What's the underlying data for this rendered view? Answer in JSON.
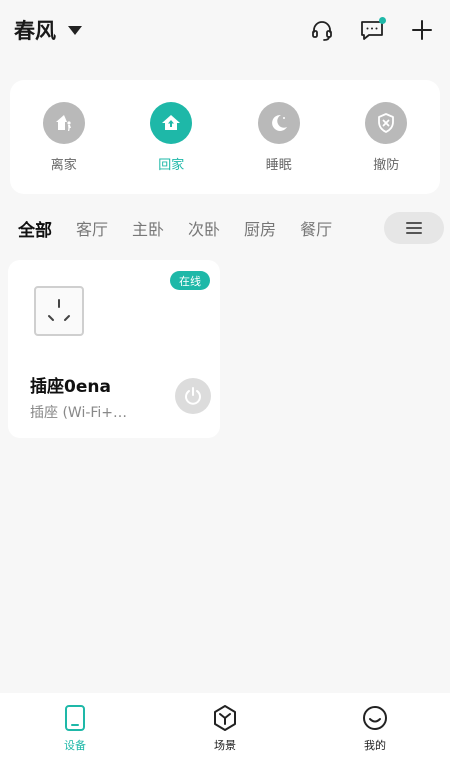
{
  "header": {
    "home_name": "春风",
    "icons": [
      "headset-icon",
      "message-icon",
      "plus-icon"
    ],
    "has_unread_message": true
  },
  "modes": [
    {
      "label": "离家",
      "icon": "leave-home-icon",
      "active": false
    },
    {
      "label": "回家",
      "icon": "go-home-icon",
      "active": true
    },
    {
      "label": "睡眠",
      "icon": "moon-icon",
      "active": false
    },
    {
      "label": "撤防",
      "icon": "shield-x-icon",
      "active": false
    }
  ],
  "rooms": [
    {
      "label": "全部",
      "active": true
    },
    {
      "label": "客厅",
      "active": false
    },
    {
      "label": "主卧",
      "active": false
    },
    {
      "label": "次卧",
      "active": false
    },
    {
      "label": "厨房",
      "active": false
    },
    {
      "label": "餐厅",
      "active": false
    }
  ],
  "devices": [
    {
      "status": "在线",
      "name": "插座0ena",
      "type": "插座 (Wi-Fi+…",
      "icon": "socket-icon",
      "power": "off"
    }
  ],
  "bottom_nav": [
    {
      "label": "设备",
      "icon": "device-icon",
      "active": true
    },
    {
      "label": "场景",
      "icon": "scene-icon",
      "active": false
    },
    {
      "label": "我的",
      "icon": "profile-icon",
      "active": false
    }
  ],
  "colors": {
    "accent": "#1eb8a8",
    "inactive_mode": "#b9b9b9",
    "background": "#f7f7f7"
  }
}
